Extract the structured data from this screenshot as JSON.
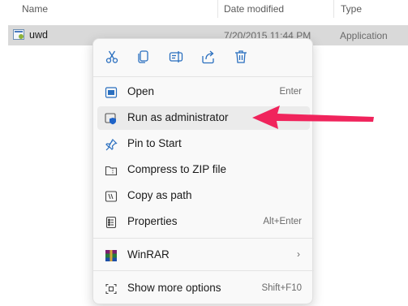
{
  "explorer": {
    "columns": {
      "name": "Name",
      "date": "Date modified",
      "type": "Type"
    },
    "file": {
      "name": "uwd",
      "date": "7/20/2015 11:44 PM",
      "type": "Application"
    }
  },
  "context_menu": {
    "quick_actions": [
      "cut-icon",
      "copy-icon",
      "rename-icon",
      "share-icon",
      "delete-icon"
    ],
    "items": [
      {
        "label": "Open",
        "shortcut": "Enter",
        "icon": "app-window-icon"
      },
      {
        "label": "Run as administrator",
        "shortcut": "",
        "icon": "shield-icon",
        "highlighted": true
      },
      {
        "label": "Pin to Start",
        "shortcut": "",
        "icon": "pin-icon"
      },
      {
        "label": "Compress to ZIP file",
        "shortcut": "",
        "icon": "zip-folder-icon"
      },
      {
        "label": "Copy as path",
        "shortcut": "",
        "icon": "copy-path-icon"
      },
      {
        "label": "Properties",
        "shortcut": "Alt+Enter",
        "icon": "properties-icon"
      },
      {
        "label": "WinRAR",
        "shortcut": "",
        "icon": "winrar-icon",
        "submenu": true
      },
      {
        "label": "Show more options",
        "shortcut": "Shift+F10",
        "icon": "more-options-icon"
      }
    ]
  },
  "colors": {
    "accent": "#0067c0",
    "arrow": "#f0245c",
    "selection": "#d9d9d9",
    "menu_bg": "#f9f9f9"
  }
}
